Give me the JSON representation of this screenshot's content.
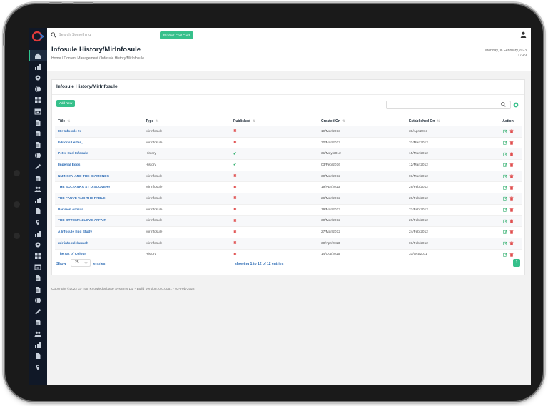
{
  "topbar": {
    "search_placeholder": "Search Something",
    "button_label": "Product Cost Card"
  },
  "header": {
    "title": "Infosule History/MirInfosule",
    "breadcrumb": "Home  /  Content Management  /  Infosule History/MirInfosule",
    "date": "Monday,06 February,2023",
    "time": "17:49"
  },
  "card": {
    "title": "Infosule History/MirInfosule",
    "add_label": "Add New"
  },
  "table": {
    "columns": [
      "Title",
      "Type",
      "Published",
      "Created On",
      "Established On",
      "Action"
    ],
    "rows": [
      {
        "title": "Mir Infosule %",
        "type": "MirInfosule",
        "published": "✖",
        "created": "19/Mar/2013",
        "established": "30/Apr/2013"
      },
      {
        "title": "Editor's Letter_",
        "type": "MirInfosule",
        "published": "✖",
        "created": "30/Mar/2012",
        "established": "31/Mar/2012"
      },
      {
        "title": "Peter Carl Infosule",
        "type": "History",
        "published": "✔",
        "created": "31/May/2012",
        "established": "15/Mar/2012"
      },
      {
        "title": "Imperial Eggs",
        "type": "History",
        "published": "✔",
        "created": "03/Feb/2016",
        "established": "12/Mar/2012"
      },
      {
        "title": "NIJINSKY AND THE DIAMONDS",
        "type": "MirInfosule",
        "published": "✖",
        "created": "30/Mar/2012",
        "established": "01/Mar/2012"
      },
      {
        "title": "THE SOLYANKA ST DISCOVERY",
        "type": "MirInfosule",
        "published": "✖",
        "created": "19/Apr/2013",
        "established": "29/Feb/2012"
      },
      {
        "title": "THE FAUVE AND THE FABLE",
        "type": "MirInfosule",
        "published": "✖",
        "created": "26/Mar/2012",
        "established": "28/Feb/2012"
      },
      {
        "title": "Parisien Artisan",
        "type": "MirInfosule",
        "published": "✖",
        "created": "19/Mar/2013",
        "established": "27/Feb/2012"
      },
      {
        "title": "THE OTTOMAN LOVE AFFAIR",
        "type": "MirInfosule",
        "published": "✖",
        "created": "30/Mar/2012",
        "established": "26/Feb/2012"
      },
      {
        "title": "A Infosule Egg Study",
        "type": "MirInfosule",
        "published": "✖",
        "created": "27/Mar/2012",
        "established": "24/Feb/2012"
      },
      {
        "title": "mir infosulelaunch",
        "type": "MirInfosule",
        "published": "✖",
        "created": "30/Apr/2013",
        "established": "01/Feb/2012"
      },
      {
        "title": "The Art of Colour",
        "type": "History",
        "published": "✖",
        "created": "14/Oct/2015",
        "established": "31/Oct/2011"
      }
    ]
  },
  "pagination": {
    "show_label": "Show",
    "page_size": "25",
    "entries_label": "entries",
    "showing": "showing 1 to 12 of 12 entries",
    "current_page": "1"
  },
  "footer": "Copyright ©2022 G-Trac Knowledgebase Systems Ltd - Build Version: 0.0.0051 - 03-Feb-2022",
  "colors": {
    "accent": "#36c08b",
    "sidebar": "#101827",
    "link": "#2f6db5",
    "danger": "#e05050"
  },
  "sidebar_icons": [
    "home-icon",
    "chart-icon",
    "settings-icon",
    "globe-icon",
    "grid-icon",
    "calendar-icon",
    "document-icon",
    "document-icon",
    "document-icon",
    "globe-icon",
    "tool-icon",
    "document-icon",
    "users-icon",
    "chart-icon",
    "file-icon",
    "pin-icon",
    "chart-icon",
    "gear-icon",
    "grid-icon",
    "calendar-icon",
    "document-icon",
    "document-icon",
    "globe-icon",
    "tool-icon",
    "document-icon",
    "users-icon",
    "chart-icon",
    "file-icon",
    "pin-icon"
  ]
}
